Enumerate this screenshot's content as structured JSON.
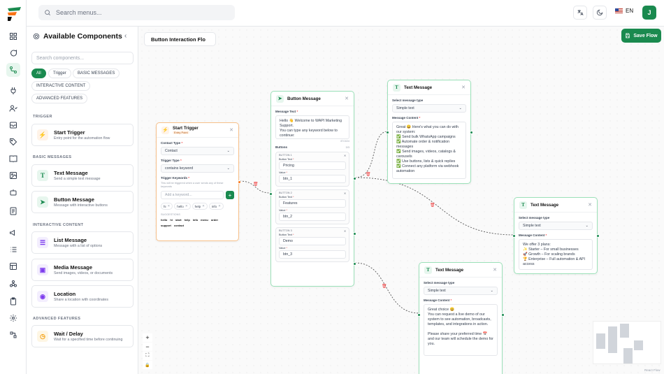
{
  "topbar": {
    "search_placeholder": "Search menus...",
    "language": "EN",
    "avatar_initial": "J"
  },
  "panel": {
    "title": "Available Components",
    "search_placeholder": "Search components...",
    "filters": [
      "All",
      "Trigger",
      "BASIC MESSAGES",
      "INTERACTIVE CONTENT",
      "ADVANCED FEATURES"
    ],
    "sections": {
      "trigger": "TRIGGER",
      "basic": "BASIC MESSAGES",
      "interactive": "INTERACTIVE CONTENT",
      "advanced": "ADVANCED FEATURES"
    },
    "components": [
      {
        "title": "Start Trigger",
        "desc": "Entry point for the automation flow",
        "icon": "zap-icon",
        "color": "#f97316",
        "bg": "#fff3e8"
      },
      {
        "title": "Text Message",
        "desc": "Send a simple text message",
        "icon": "text-icon",
        "color": "#1a8a4f",
        "bg": "#e7f6ee"
      },
      {
        "title": "Button Message",
        "desc": "Message with interactive buttons",
        "icon": "cursor-icon",
        "color": "#1a8a4f",
        "bg": "#e7f6ee"
      },
      {
        "title": "List Message",
        "desc": "Message with a list of options",
        "icon": "list-icon",
        "color": "#7c3aed",
        "bg": "#f3eefe"
      },
      {
        "title": "Media Message",
        "desc": "Send images, videos, or documents",
        "icon": "image-icon",
        "color": "#7c3aed",
        "bg": "#f3eefe"
      },
      {
        "title": "Location",
        "desc": "Share a location with coordinates",
        "icon": "map-pin-icon",
        "color": "#7c3aed",
        "bg": "#f3eefe"
      },
      {
        "title": "Wait / Delay",
        "desc": "Wait for a specified time before continuing",
        "icon": "clock-icon",
        "color": "#f59e0b",
        "bg": "#fef6e4"
      }
    ]
  },
  "canvas": {
    "flow_name": "Button Interaction Flo",
    "save_label": "Save Flow",
    "zoom_controls": [
      "+",
      "−",
      "⛶",
      "🔒"
    ],
    "attribution": "React Flow"
  },
  "nodes": {
    "trigger": {
      "title": "Start Trigger",
      "badge": "Entry Point",
      "contact_type_label": "Contact Type",
      "contact_type": "Contact",
      "trigger_type_label": "Trigger Type",
      "trigger_type": "contains keyword",
      "keywords_label": "Trigger Keywords",
      "keywords_help": "This will be triggered when a user sends any of these keywords",
      "keyword_placeholder": "Add a keyword...",
      "keywords": [
        "hi",
        "hello",
        "help",
        "info"
      ],
      "suggestions_label": "SUGGESTIONS",
      "suggestions": [
        "hello",
        "hi",
        "start",
        "help",
        "info",
        "menu",
        "order",
        "support",
        "contact"
      ]
    },
    "button_msg": {
      "title": "Button Message",
      "text_label": "Message Text",
      "text": "Hello 👋 Welcome to WAPI Marketing Support.\nYou can type any keyword below to continue:",
      "char_count": "87/1024",
      "buttons_label": "Buttons",
      "buttons_count": "3/3",
      "buttons": [
        {
          "label": "BUTTON 1",
          "text_label": "Button Text",
          "text": "Pricing",
          "value_label": "Value",
          "value": "btn_1"
        },
        {
          "label": "BUTTON 2",
          "text_label": "Button Text",
          "text": "Features",
          "value_label": "Value",
          "value": "btn_2"
        },
        {
          "label": "BUTTON 3",
          "text_label": "Button Text",
          "text": "Demo",
          "value_label": "Value",
          "value": "btn_3"
        }
      ]
    },
    "text1": {
      "title": "Text Message",
      "type_label": "Select message type",
      "type": "Simple text",
      "content_label": "Message Content",
      "content": "Great 😄 Here's what you can do with our system:\n✅ Send bulk WhatsApp campaigns\n✅ Automate order & notification messages\n✅ Send images, videos, catalogs & carousels\n✅ Use buttons, lists & quick replies\n✅ Connect any platform via webhook automation"
    },
    "text2": {
      "title": "Text Message",
      "type_label": "Select message type",
      "type": "Simple text",
      "content_label": "Message Content",
      "content": "We offer 3 plans:\n✨ Starter – For small businesses\n🚀 Growth – For scaling brands\n🏆 Enterprise – Full automation & API access"
    },
    "text3": {
      "title": "Text Message",
      "type_label": "Select message type",
      "type": "Simple text",
      "content_label": "Message Content",
      "content": "Great choice 😄\nYou can request a live demo of our system to see automation, broadcasts, templates, and integrations in action.\n\nPlease share your preferred time 📅 and our team will schedule the demo for you."
    }
  }
}
